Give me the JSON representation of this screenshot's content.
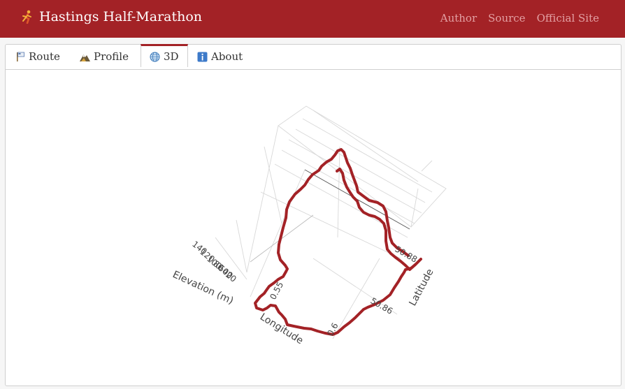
{
  "app": {
    "title": "Hastings Half-Marathon",
    "nav": [
      "Author",
      "Source",
      "Official Site"
    ]
  },
  "tabs": [
    {
      "label": "Route",
      "icon": "route-marker-icon",
      "active": false
    },
    {
      "label": "Profile",
      "icon": "mountain-icon",
      "active": false
    },
    {
      "label": "3D",
      "icon": "globe-icon",
      "active": true
    },
    {
      "label": "About",
      "icon": "info-icon",
      "active": false
    }
  ],
  "chart_data": {
    "type": "line",
    "projection": "3d",
    "xlabel": "Longitude",
    "ylabel": "Latitude",
    "zlabel": "Elevation (m)",
    "x_ticks": [
      "0.55",
      "0.6"
    ],
    "y_ticks": [
      "50.86",
      "50.88"
    ],
    "z_ticks": [
      "140",
      "120",
      "100",
      "80",
      "60",
      "40",
      "20"
    ],
    "series_color": "#a32226",
    "grid": true
  }
}
